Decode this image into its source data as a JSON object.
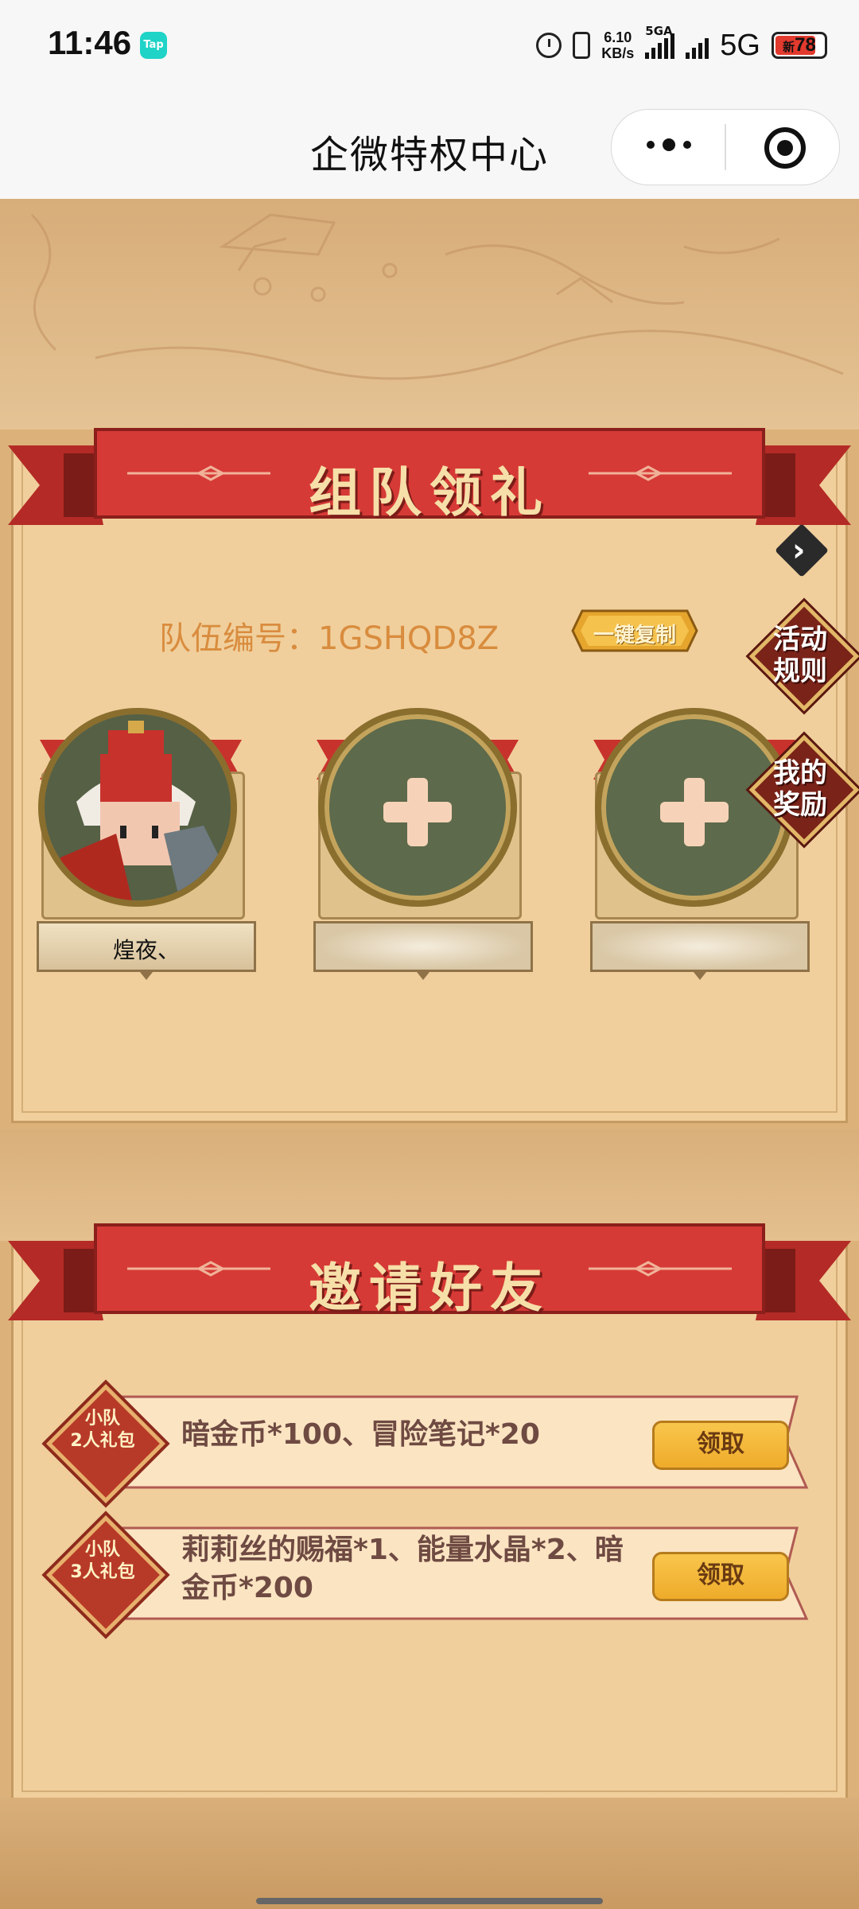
{
  "status_bar": {
    "time": "11:46",
    "app_badge": "Tap",
    "net_speed_value": "6.10",
    "net_speed_unit": "KB/s",
    "sim_label": "5GA",
    "network": "5G",
    "battery_prefix": "新",
    "battery": "78"
  },
  "nav": {
    "title": "企微特权中心"
  },
  "team_section": {
    "banner_title": "组队领礼",
    "team_id": "队伍编号：1GSHQD8Z",
    "copy_button": "一键复制",
    "rules_badge": "活动\n规则",
    "rewards_badge": "我的\n奖励",
    "members": [
      {
        "name": "煌夜、",
        "filled": true
      },
      {
        "name": "",
        "filled": false
      },
      {
        "name": "",
        "filled": false
      }
    ]
  },
  "invite_section": {
    "banner_title": "邀请好友",
    "rewards": [
      {
        "tag_top": "小队",
        "tag_bottom": "2人礼包",
        "items": "暗金币*100、冒险笔记*20",
        "claim": "领取"
      },
      {
        "tag_top": "小队",
        "tag_bottom": "3人礼包",
        "items": "莉莉丝的赐福*1、能量水晶*2、暗金币*200",
        "claim": "领取"
      }
    ]
  },
  "colors": {
    "banner_red": "#d63a36",
    "parchment": "#f0cf9c",
    "team_id_orange": "#d98c3e",
    "claim_gold": "#f5b93c"
  }
}
